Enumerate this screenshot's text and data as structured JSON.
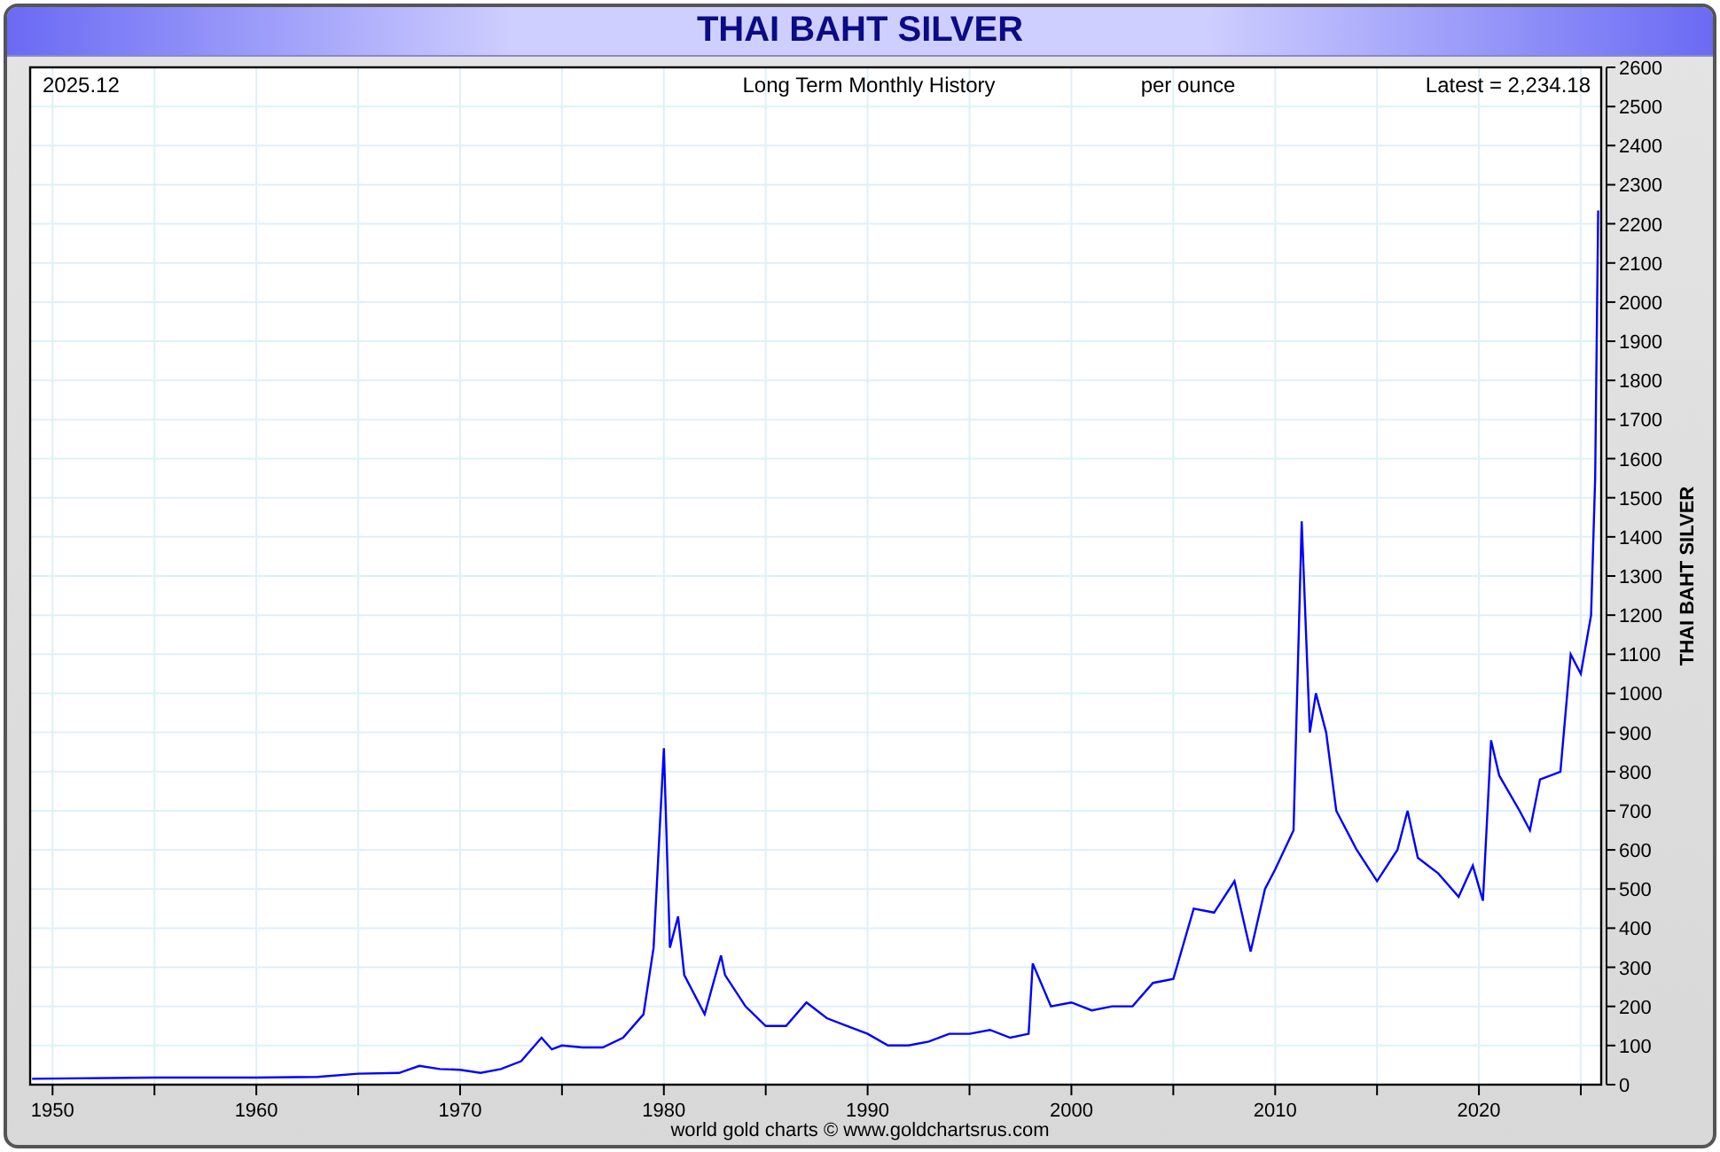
{
  "title": "THAI BAHT SILVER",
  "chart": {
    "date": "2025.12",
    "subtitle": "Long Term Monthly History",
    "unit": "per ounce",
    "latest": "Latest = 2,234.18",
    "chart_data": {
      "type": "line",
      "ylabel": "THAI BAHT SILVER",
      "xlim": [
        1948.9,
        2026
      ],
      "grid": true,
      "ylim": [
        0,
        2600
      ],
      "xticks": [
        1950,
        1960,
        1970,
        1980,
        1990,
        2000,
        2010,
        2020
      ],
      "yticks": [
        0,
        100,
        200,
        300,
        400,
        500,
        600,
        700,
        800,
        900,
        1000,
        1100,
        1200,
        1300,
        1400,
        1500,
        1600,
        1700,
        1800,
        1900,
        2000,
        2100,
        2200,
        2300,
        2400,
        2500,
        2600
      ],
      "x": [
        1949,
        1955,
        1960,
        1963,
        1965,
        1967,
        1968,
        1969,
        1970,
        1971,
        1972,
        1973,
        1974,
        1974.5,
        1975,
        1976,
        1977,
        1978,
        1979,
        1979.5,
        1980,
        1980.3,
        1980.7,
        1981,
        1982,
        1982.8,
        1983,
        1984,
        1985,
        1986,
        1987,
        1988,
        1989,
        1990,
        1991,
        1992,
        1993,
        1994,
        1995,
        1996,
        1997,
        1997.9,
        1998.1,
        1999,
        2000,
        2001,
        2002,
        2003,
        2004,
        2005,
        2006,
        2007,
        2008,
        2008.8,
        2009.5,
        2010,
        2010.9,
        2011.3,
        2011.7,
        2012,
        2012.5,
        2013,
        2014,
        2015,
        2016,
        2016.5,
        2017,
        2018,
        2019,
        2019.7,
        2020.2,
        2020.6,
        2021,
        2022,
        2022.5,
        2023,
        2024,
        2024.5,
        2025,
        2025.5,
        2025.7,
        2025.85
      ],
      "series": [
        {
          "color": "#0000ff",
          "values": [
            15,
            18,
            18,
            20,
            28,
            30,
            48,
            40,
            38,
            30,
            40,
            60,
            120,
            90,
            100,
            95,
            95,
            120,
            180,
            350,
            860,
            350,
            430,
            280,
            180,
            330,
            280,
            200,
            150,
            150,
            210,
            170,
            150,
            130,
            100,
            100,
            110,
            130,
            130,
            140,
            120,
            130,
            310,
            200,
            210,
            190,
            200,
            200,
            260,
            270,
            450,
            440,
            520,
            340,
            500,
            550,
            650,
            1440,
            900,
            1000,
            900,
            700,
            600,
            520,
            600,
            700,
            580,
            540,
            480,
            560,
            470,
            880,
            790,
            700,
            650,
            780,
            800,
            1100,
            1050,
            1200,
            1550,
            2234
          ]
        }
      ]
    }
  },
  "credit": "world gold charts © www.goldchartsrus.com"
}
